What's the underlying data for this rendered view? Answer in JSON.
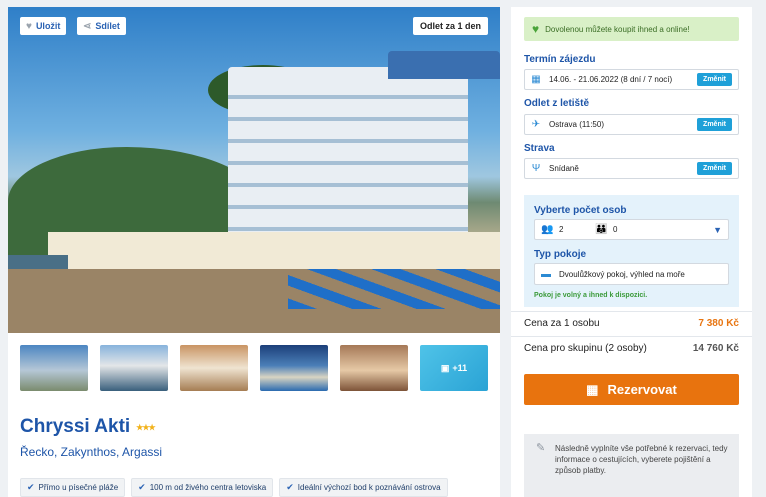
{
  "hero": {
    "save_label": "Uložit",
    "share_label": "Sdílet",
    "departure_badge": "Odlet za 1 den"
  },
  "gallery": {
    "more_label": "+11"
  },
  "hotel": {
    "name": "Chryssi Akti",
    "stars": "★★★",
    "location": "Řecko, Zakynthos, Argassi",
    "features": [
      "Přímo u písečné pláže",
      "100 m od živého centra letoviska",
      "Ideální výchozí bod k poznávání ostrova"
    ]
  },
  "booking": {
    "banner": "Dovolenou můžete koupit ihned a online!",
    "term_label": "Termín zájezdu",
    "term_value": "14.06. - 21.06.2022 (8 dní / 7 nocí)",
    "airport_label": "Odlet z letiště",
    "airport_value": "Ostrava (11:50)",
    "board_label": "Strava",
    "board_value": "Snídaně",
    "change_label": "Změnit",
    "persons_label": "Vyberte počet osob",
    "adults": "2",
    "children": "0",
    "room_label": "Typ pokoje",
    "room_value": "Dvoulůžkový pokoj, výhled na moře",
    "availability": "Pokoj je volný a ihned k dispozici.",
    "price_person_label": "Cena za 1 osobu",
    "price_person": "7 380 Kč",
    "price_group_label": "Cena pro skupinu (2 osoby)",
    "price_group": "14 760 Kč",
    "book_label": "Rezervovat",
    "note": "Následně vyplníte vše potřebné k rezervaci, tedy informace o cestujících, vyberete pojištění a způsob platby."
  },
  "colors": {
    "accent": "#1e55a8",
    "cta": "#e8730e",
    "price": "#e87511",
    "success": "#3b9a3a"
  }
}
